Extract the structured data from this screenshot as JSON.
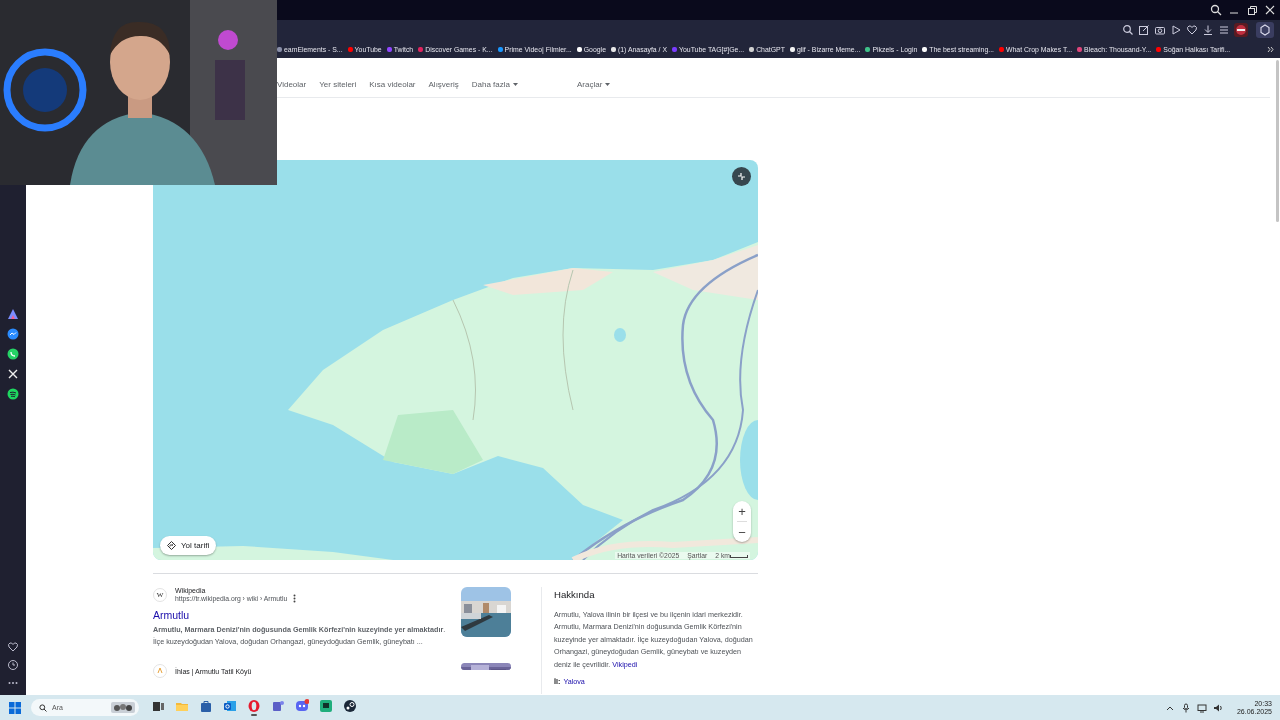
{
  "bookmarks": [
    {
      "label": "eamElements - S...",
      "color": "#8a8fa8"
    },
    {
      "label": "YouTube",
      "color": "#ff0000"
    },
    {
      "label": "Twitch",
      "color": "#9146ff"
    },
    {
      "label": "Discover Games - K...",
      "color": "#e0245e"
    },
    {
      "label": "Prime Video| Filmler...",
      "color": "#1a98ff"
    },
    {
      "label": "Google",
      "color": "#ffffff"
    },
    {
      "label": "(1) Anasayfa / X",
      "color": "#e7e7e7"
    },
    {
      "label": "YouTube TAG[#]Ge...",
      "color": "#7a3cff"
    },
    {
      "label": "ChatGPT",
      "color": "#d0d0d0"
    },
    {
      "label": "glif - Bizarre Meme...",
      "color": "#f2f2f2"
    },
    {
      "label": "Pikzels - Login",
      "color": "#3fc28a"
    },
    {
      "label": "The best streaming...",
      "color": "#fafafa"
    },
    {
      "label": "What Crop Makes T...",
      "color": "#ff0000"
    },
    {
      "label": "Bleach: Thousand-Y...",
      "color": "#e0457b"
    },
    {
      "label": "Soğan Halkası Tarifi...",
      "color": "#ff0000"
    }
  ],
  "search_tabs": [
    {
      "label": "Videolar",
      "kind": "link"
    },
    {
      "label": "Yer siteleri",
      "kind": "link"
    },
    {
      "label": "Kısa videolar",
      "kind": "link"
    },
    {
      "label": "Alışveriş",
      "kind": "link"
    },
    {
      "label": "Daha fazla",
      "kind": "dropdown"
    },
    {
      "label": "Araçlar",
      "kind": "tools"
    }
  ],
  "map": {
    "directions_button": "Yol tarifi",
    "zoom_in": "+",
    "zoom_out": "−",
    "attribution": "Harita verileri ©2025",
    "terms": "Şartlar",
    "scale": "2 km"
  },
  "results": [
    {
      "favicon": "W",
      "site": "Wikipedia",
      "url": "https://tr.wikipedia.org › wiki › Armutlu",
      "title": "Armutlu",
      "snippet": "**Armutlu, Marmara Denizi'nin doğusunda Gemlik Körfezi'nin kuzeyinde yer almaktadır**. İlçe kuzeydoğudan Yalova, doğudan Orhangazi, güneydoğudan Gemlik, güneybatı ..."
    },
    {
      "site": "İhlas | Armutlu Tatil Köyü"
    }
  ],
  "about": {
    "heading": "Hakkında",
    "text": "Armutlu, Yalova ilinin bir ilçesi ve bu ilçenin idari merkezidir. Armutlu, Marmara Denizi'nin doğusunda Gemlik Körfezi'nin kuzeyinde yer almaktadır. İlçe kuzeydoğudan Yalova, doğudan Orhangazi, güneydoğudan Gemlik, güneybatı ve kuzeyden deniz ile çevrilidir.",
    "source_link": "Vikipedi",
    "facts": [
      {
        "label": "İl:",
        "value": "Yalova"
      }
    ]
  },
  "taskbar": {
    "search_placeholder": "Ara",
    "apps": [
      {
        "kind": "taskview",
        "active": false
      },
      {
        "kind": "folder",
        "active": false
      },
      {
        "kind": "store",
        "active": false
      },
      {
        "kind": "mail",
        "active": false
      },
      {
        "kind": "browser",
        "active": true
      },
      {
        "kind": "team",
        "active": false
      },
      {
        "kind": "chat",
        "active": false
      },
      {
        "kind": "terminal",
        "active": false
      },
      {
        "kind": "steam",
        "active": false
      }
    ],
    "time": "20:33",
    "date": "26.06.2025"
  }
}
